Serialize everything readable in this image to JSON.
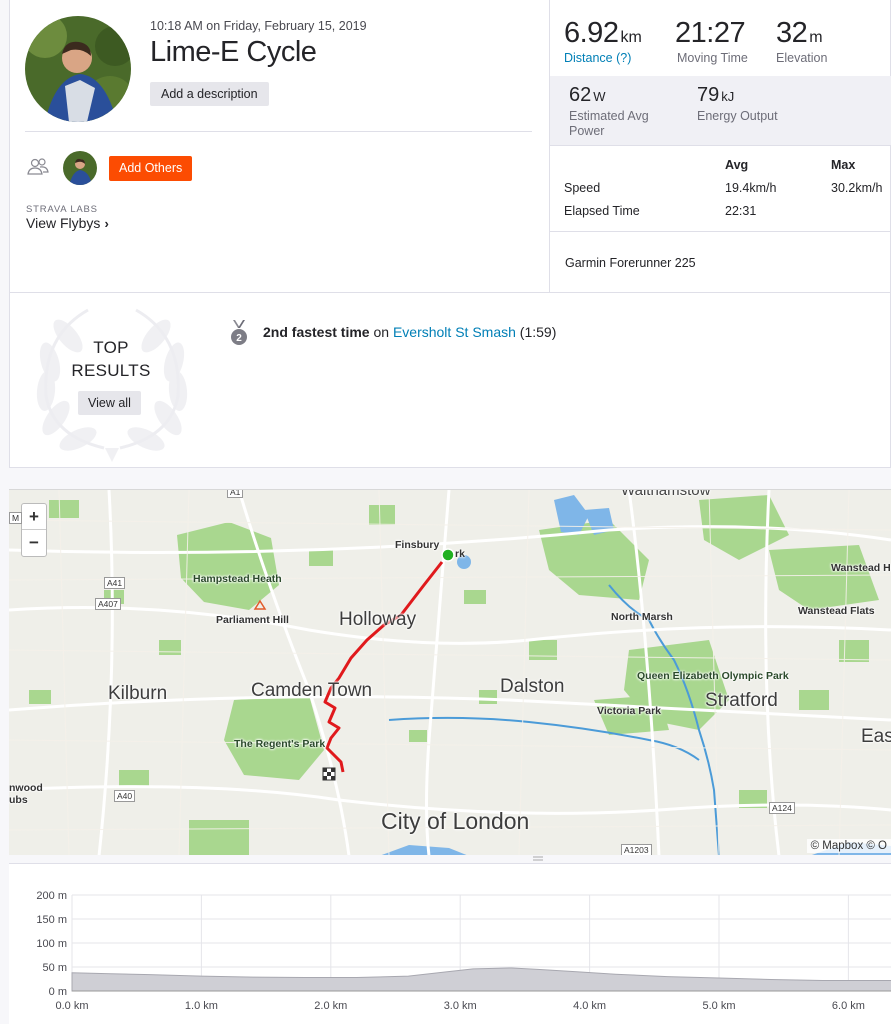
{
  "activity": {
    "datetime": "10:18 AM on Friday, February 15, 2019",
    "title": "Lime-E Cycle",
    "description_button": "Add a description",
    "add_others_button": "Add Others",
    "labs_label": "STRAVA LABS",
    "flybys_label": "View Flybys"
  },
  "stats": {
    "distance": {
      "value": "6.92",
      "unit": "km",
      "label": "Distance (?)"
    },
    "moving_time": {
      "value": "21:27",
      "label": "Moving Time"
    },
    "elevation": {
      "value": "32",
      "unit": "m",
      "label": "Elevation"
    },
    "power": {
      "value": "62",
      "unit": "W",
      "label": "Estimated Avg Power"
    },
    "energy": {
      "value": "79",
      "unit": "kJ",
      "label": "Energy Output"
    }
  },
  "splits_table": {
    "headers": [
      "Avg",
      "Max"
    ],
    "rows": [
      {
        "label": "Speed",
        "avg": "19.4km/h",
        "max": "30.2km/h"
      },
      {
        "label": "Elapsed Time",
        "avg": "22:31",
        "max": ""
      }
    ]
  },
  "device": "Garmin Forerunner 225",
  "top_results": {
    "title_line1": "TOP",
    "title_line2": "RESULTS",
    "view_all": "View all",
    "medal_rank": "2",
    "achievement_bold": "2nd fastest time",
    "achievement_on": " on ",
    "segment": "Eversholt St Smash",
    "segment_time": " (1:59)"
  },
  "map": {
    "zoom_in": "+",
    "zoom_out": "−",
    "attribution": "© Mapbox © O",
    "route_color": "#e0191c",
    "start_color": "#20b020",
    "places": {
      "finsbury": "Finsbury",
      "finsbury_tail": "rk",
      "holloway": "Holloway",
      "camden": "Camden Town",
      "kilburn": "Kilburn",
      "dalston": "Dalston",
      "stratford": "Stratford",
      "city": "City of London",
      "hampstead": "Hampstead Heath",
      "parliament": "Parliament Hill",
      "regents": "The Regent's Park",
      "north_marsh": "North Marsh",
      "qe_park": "Queen Elizabeth Olympic Park",
      "victoria": "Victoria Park",
      "wanstead_heath": "Wanstead Heath",
      "wanstead_flats": "Wanstead Flats",
      "east": "Eas",
      "wood": "nwood",
      "wood2": "ubs",
      "walthamstow": "Walthamstow"
    },
    "roads": {
      "a41": "A41",
      "a407": "A407",
      "a40": "A40",
      "a124": "A124",
      "a1203": "A1203",
      "a1": "A1",
      "m": "M"
    }
  },
  "chart_data": {
    "type": "area",
    "title": "",
    "xlabel": "",
    "ylabel": "",
    "x_unit": "km",
    "y_unit": "m",
    "xlim": [
      0,
      6.92
    ],
    "ylim": [
      0,
      200
    ],
    "x_ticks": [
      "0.0 km",
      "1.0 km",
      "2.0 km",
      "3.0 km",
      "4.0 km",
      "5.0 km",
      "6.0 km"
    ],
    "y_ticks": [
      "200 m",
      "150 m",
      "100 m",
      "50 m",
      "0 m"
    ],
    "x": [
      0,
      0.3,
      0.6,
      1.0,
      1.4,
      1.8,
      2.2,
      2.6,
      2.9,
      3.1,
      3.4,
      3.6,
      3.9,
      4.2,
      4.6,
      5.0,
      5.4,
      5.8,
      6.2,
      6.6,
      6.92
    ],
    "values": [
      38,
      36,
      34,
      31,
      29,
      28,
      28,
      31,
      40,
      46,
      48,
      45,
      40,
      35,
      30,
      27,
      24,
      22,
      22,
      22,
      22
    ],
    "grid": true
  }
}
